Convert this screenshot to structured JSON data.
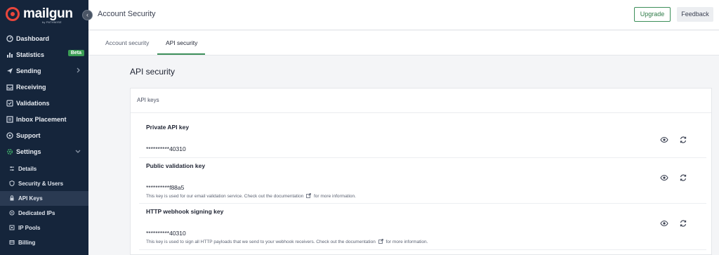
{
  "brand": {
    "name": "mailgun",
    "sub": "by PATHWISE"
  },
  "sidebar": {
    "items": [
      {
        "label": "Dashboard"
      },
      {
        "label": "Statistics",
        "badge": "Beta"
      },
      {
        "label": "Sending"
      },
      {
        "label": "Receiving"
      },
      {
        "label": "Validations"
      },
      {
        "label": "Inbox Placement"
      },
      {
        "label": "Support"
      },
      {
        "label": "Settings"
      }
    ],
    "settings_items": [
      {
        "label": "Details"
      },
      {
        "label": "Security & Users"
      },
      {
        "label": "API Keys"
      },
      {
        "label": "Dedicated IPs"
      },
      {
        "label": "IP Pools"
      },
      {
        "label": "Billing"
      }
    ]
  },
  "header": {
    "title": "Account Security",
    "upgrade_label": "Upgrade",
    "feedback_label": "Feedback"
  },
  "tabs": [
    {
      "label": "Account security"
    },
    {
      "label": "API security"
    }
  ],
  "main": {
    "title": "API security",
    "card_title": "API keys",
    "keys": [
      {
        "name": "Private API key",
        "value": "**********40310",
        "note": ""
      },
      {
        "name": "Public validation key",
        "value": "**********f88a5",
        "note_before": "This key is used for our email validation service. Check out the documentation",
        "note_after": "for more information."
      },
      {
        "name": "HTTP webhook signing key",
        "value": "**********40310",
        "note_before": "This key is used to sign all HTTP payloads that we send to your webhook receivers. Check out the documentation",
        "note_after": "for more information."
      }
    ]
  },
  "colors": {
    "sidebar_bg": "#15253b",
    "accent_green": "#3d8f5a",
    "brand_red": "#e8463c"
  }
}
